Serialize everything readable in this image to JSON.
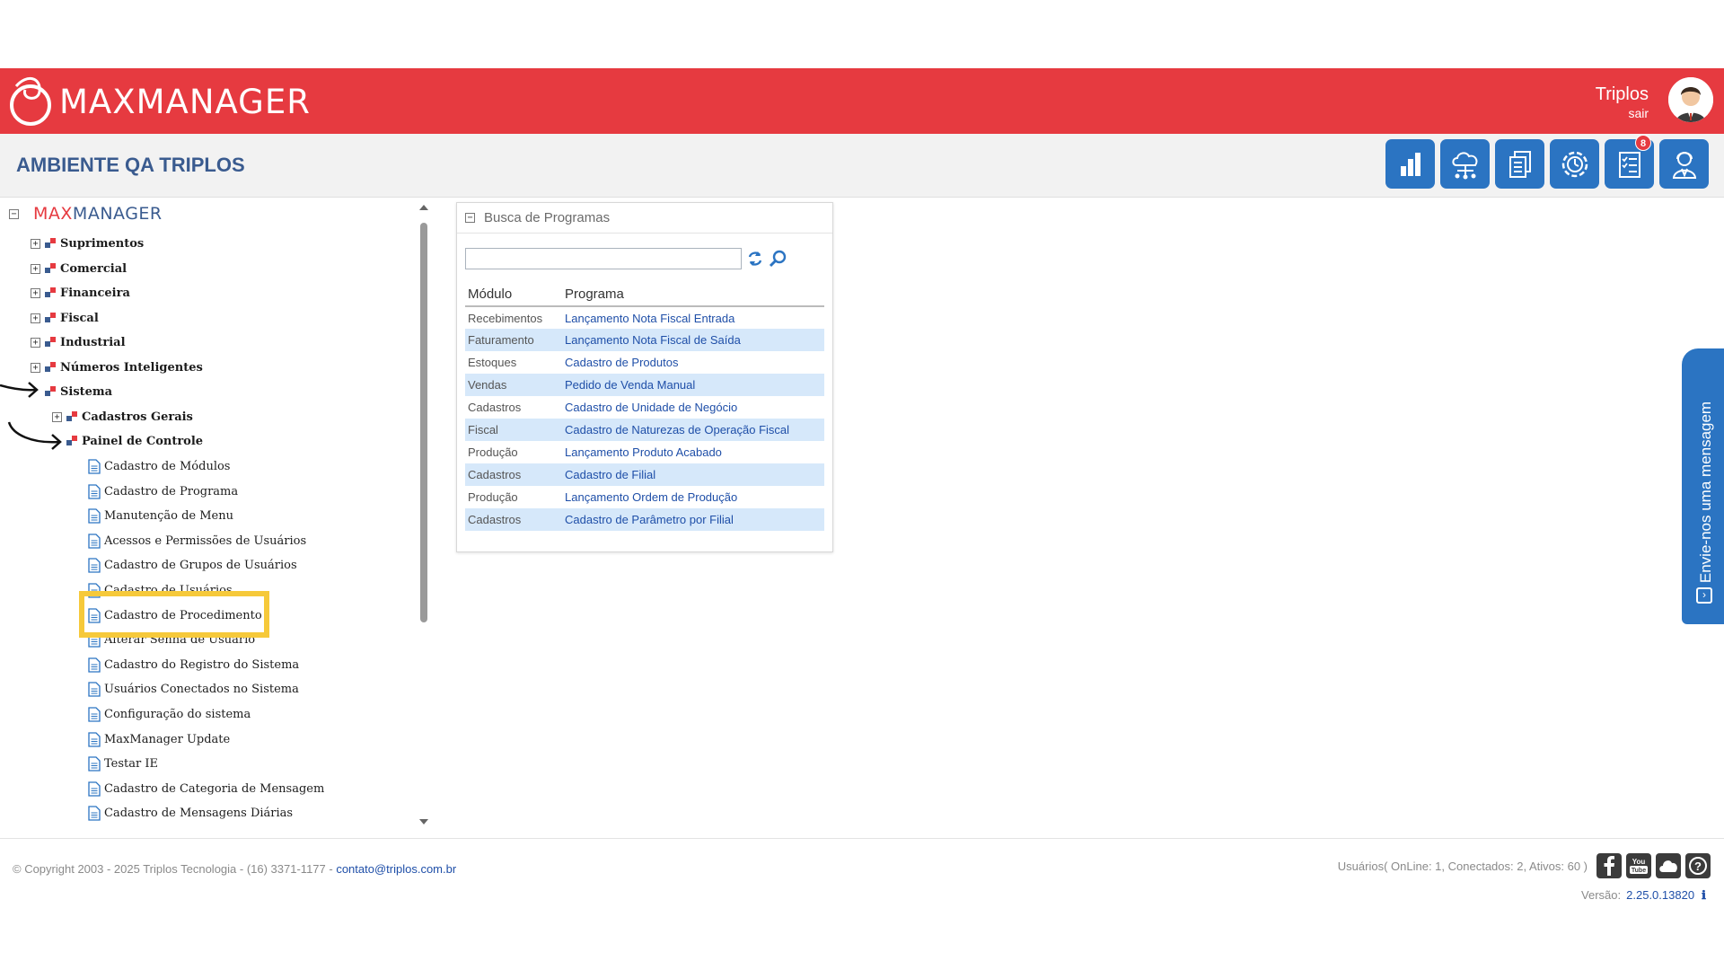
{
  "header": {
    "logo_text": "MAXMANAGER",
    "user_name": "Triplos",
    "logout_label": "sair",
    "environment_title": "AMBIENTE QA TRIPLOS",
    "notification_count": "8",
    "brand_color": "#e63a40",
    "accent_color": "#2b74c2",
    "toolbar_icons": [
      "chart-icon",
      "cloud-network-icon",
      "documents-icon",
      "settings-cycle-icon",
      "checklist-icon",
      "user-support-icon"
    ]
  },
  "tree": {
    "root_max": "MAX",
    "root_manager": "MANAGER",
    "top_nodes": [
      {
        "label": "Suprimentos"
      },
      {
        "label": "Comercial"
      },
      {
        "label": "Financeira"
      },
      {
        "label": "Fiscal"
      },
      {
        "label": "Industrial"
      },
      {
        "label": "Números Inteligentes"
      },
      {
        "label": "Sistema"
      }
    ],
    "sistema_children": [
      {
        "label": "Cadastros Gerais"
      },
      {
        "label": "Painel de Controle"
      }
    ],
    "painel_items": [
      "Cadastro de Módulos",
      "Cadastro de Programa",
      "Manutenção de Menu",
      "Acessos e Permissões de Usuários",
      "Cadastro de Grupos de Usuários",
      "Cadastro de Usuários",
      "Cadastro de Procedimento",
      "Alterar Senha de Usuário",
      "Cadastro do Registro do Sistema",
      "Usuários Conectados no Sistema",
      "Configuração do sistema",
      "MaxManager Update",
      "Testar IE",
      "Cadastro de Categoria de Mensagem",
      "Cadastro de Mensagens Diárias"
    ]
  },
  "search_panel": {
    "title": "Busca de Programas",
    "search_value": "",
    "col_module": "Módulo",
    "col_program": "Programa",
    "rows": [
      {
        "module": "Recebimentos",
        "program": "Lançamento Nota Fiscal Entrada"
      },
      {
        "module": "Faturamento",
        "program": "Lançamento Nota Fiscal de Saída"
      },
      {
        "module": "Estoques",
        "program": "Cadastro de Produtos"
      },
      {
        "module": "Vendas",
        "program": "Pedido de Venda Manual"
      },
      {
        "module": "Cadastros",
        "program": "Cadastro de Unidade de Negócio"
      },
      {
        "module": "Fiscal",
        "program": "Cadastro de Naturezas de Operação Fiscal"
      },
      {
        "module": "Produção",
        "program": "Lançamento Produto Acabado"
      },
      {
        "module": "Cadastros",
        "program": "Cadastro de Filial"
      },
      {
        "module": "Produção",
        "program": "Lançamento Ordem de Produção"
      },
      {
        "module": "Cadastros",
        "program": "Cadastro de Parâmetro por Filial"
      }
    ]
  },
  "side_tab": {
    "label": "Envie-nos uma mensagem"
  },
  "footer": {
    "copyright": "© Copyright 2003 - 2025 Triplos Tecnologia - (16) 3371-1177 - ",
    "contact_email": "contato@triplos.com.br",
    "users_info": "Usuários( OnLine: 1, Conectados: 2, Ativos: 60 )",
    "version_label": "Versão:",
    "version_value": "2.25.0.13820",
    "info_glyph": "ℹ",
    "social_icons": [
      "facebook-icon",
      "youtube-icon",
      "cloud-icon",
      "help-icon"
    ]
  }
}
